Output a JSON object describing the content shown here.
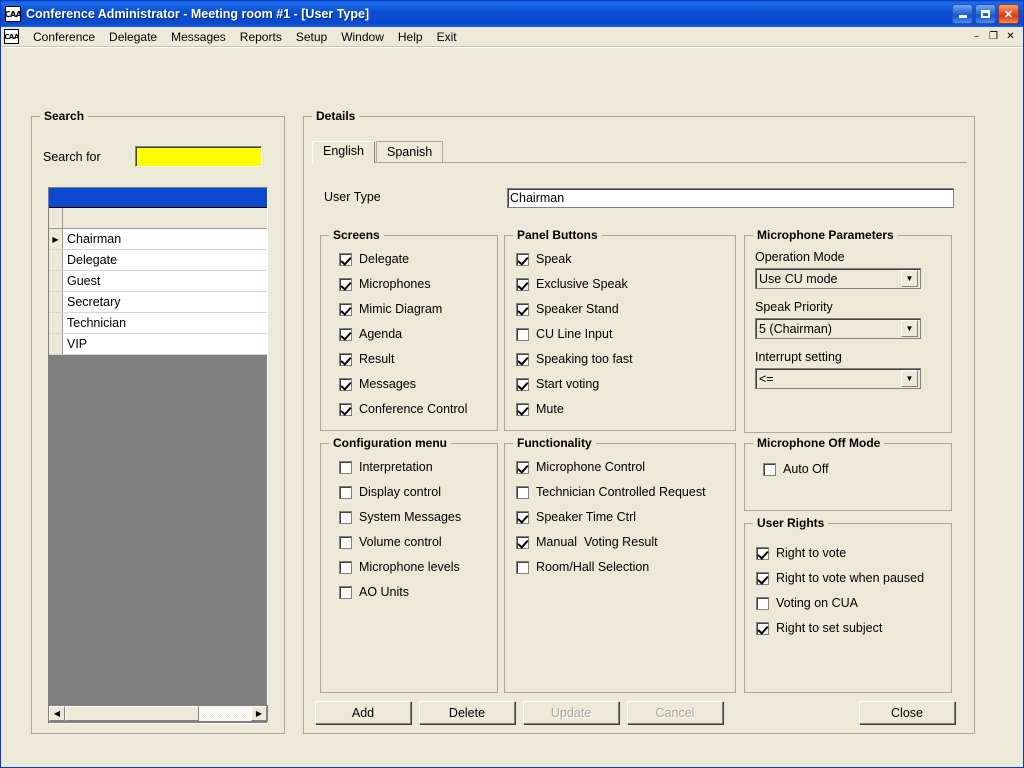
{
  "window": {
    "title": "Conference Administrator  -  Meeting room #1  -  [User Type]",
    "app_icon_text": "CAA",
    "minimize_label": "minimize",
    "maximize_label": "maximize",
    "close_label": "✕"
  },
  "menubar": {
    "mdi_icon_text": "CAA",
    "items": [
      {
        "label": "Conference"
      },
      {
        "label": "Delegate"
      },
      {
        "label": "Messages"
      },
      {
        "label": "Reports"
      },
      {
        "label": "Setup"
      },
      {
        "label": "Window"
      },
      {
        "label": "Help"
      },
      {
        "label": "Exit"
      }
    ],
    "mdi_buttons": [
      {
        "label": "–",
        "name": "mdi-minimize-button"
      },
      {
        "label": "❐",
        "name": "mdi-restore-button"
      },
      {
        "label": "✕",
        "name": "mdi-close-button"
      }
    ]
  },
  "search": {
    "group_title": "Search",
    "label": "Search for",
    "value": "",
    "placeholder": "",
    "grid": {
      "rows": [
        {
          "indicator": "▶",
          "name": "Chairman"
        },
        {
          "indicator": "",
          "name": "Delegate"
        },
        {
          "indicator": "",
          "name": "Guest"
        },
        {
          "indicator": "",
          "name": "Secretary"
        },
        {
          "indicator": "",
          "name": "Technician"
        },
        {
          "indicator": "",
          "name": "VIP"
        }
      ]
    },
    "scrollbar": {
      "left_arrow": "◀",
      "right_arrow": "▶"
    }
  },
  "details": {
    "group_title": "Details",
    "tabs": [
      {
        "label": "English",
        "active": true
      },
      {
        "label": "Spanish",
        "active": false
      }
    ],
    "user_type": {
      "label": "User Type",
      "value": "Chairman"
    },
    "screens": {
      "group_title": "Screens",
      "items": [
        {
          "label": "Delegate",
          "checked": true
        },
        {
          "label": "Microphones",
          "checked": true
        },
        {
          "label": "Mimic Diagram",
          "checked": true
        },
        {
          "label": "Agenda",
          "checked": true
        },
        {
          "label": "Result",
          "checked": true
        },
        {
          "label": "Messages",
          "checked": true
        },
        {
          "label": "Conference Control",
          "checked": true
        }
      ]
    },
    "panel_buttons": {
      "group_title": "Panel Buttons",
      "items": [
        {
          "label": "Speak",
          "checked": true
        },
        {
          "label": "Exclusive Speak",
          "checked": true
        },
        {
          "label": "Speaker Stand",
          "checked": true
        },
        {
          "label": "CU Line Input",
          "checked": false
        },
        {
          "label": "Speaking too fast",
          "checked": true
        },
        {
          "label": "Start voting",
          "checked": true
        },
        {
          "label": "Mute",
          "checked": true
        }
      ]
    },
    "microphone_parameters": {
      "group_title": "Microphone Parameters",
      "fields": [
        {
          "label": "Operation Mode",
          "value": "Use CU mode"
        },
        {
          "label": "Speak Priority",
          "value": "5 (Chairman)"
        },
        {
          "label": "Interrupt setting",
          "value": "<="
        }
      ]
    },
    "configuration_menu": {
      "group_title": "Configuration menu",
      "items": [
        {
          "label": "Interpretation",
          "checked": false
        },
        {
          "label": "Display control",
          "checked": false
        },
        {
          "label": "System Messages",
          "checked": false
        },
        {
          "label": "Volume control",
          "checked": false
        },
        {
          "label": "Microphone levels",
          "checked": false
        },
        {
          "label": "AO Units",
          "checked": false
        }
      ]
    },
    "functionality": {
      "group_title": "Functionality",
      "items": [
        {
          "label": "Microphone Control",
          "checked": true
        },
        {
          "label": "Technician Controlled Request",
          "checked": false
        },
        {
          "label": "Speaker Time Ctrl",
          "checked": true
        },
        {
          "label": "Manual  Voting Result",
          "checked": true
        },
        {
          "label": "Room/Hall Selection",
          "checked": false
        }
      ]
    },
    "microphone_off_mode": {
      "group_title": "Microphone Off Mode",
      "items": [
        {
          "label": "Auto Off",
          "checked": false
        }
      ]
    },
    "user_rights": {
      "group_title": "User Rights",
      "items": [
        {
          "label": "Right to vote",
          "checked": true
        },
        {
          "label": "Right to vote when paused",
          "checked": true
        },
        {
          "label": "Voting on CUA",
          "checked": false
        },
        {
          "label": "Right to set subject",
          "checked": true
        }
      ]
    },
    "buttons": [
      {
        "label": "Add",
        "disabled": false,
        "name": "add-button"
      },
      {
        "label": "Delete",
        "disabled": false,
        "name": "delete-button"
      },
      {
        "label": "Update",
        "disabled": true,
        "name": "update-button"
      },
      {
        "label": "Cancel",
        "disabled": true,
        "name": "cancel-button"
      },
      {
        "label": "Close",
        "disabled": false,
        "name": "close-button"
      }
    ]
  },
  "colors": {
    "titlebar_blue": "#0b49cd",
    "face": "#ece9d8",
    "search_input_yellow": "#ffff00",
    "grid_header_blue": "#0b48d0",
    "grid_filler_gray": "#808080"
  }
}
